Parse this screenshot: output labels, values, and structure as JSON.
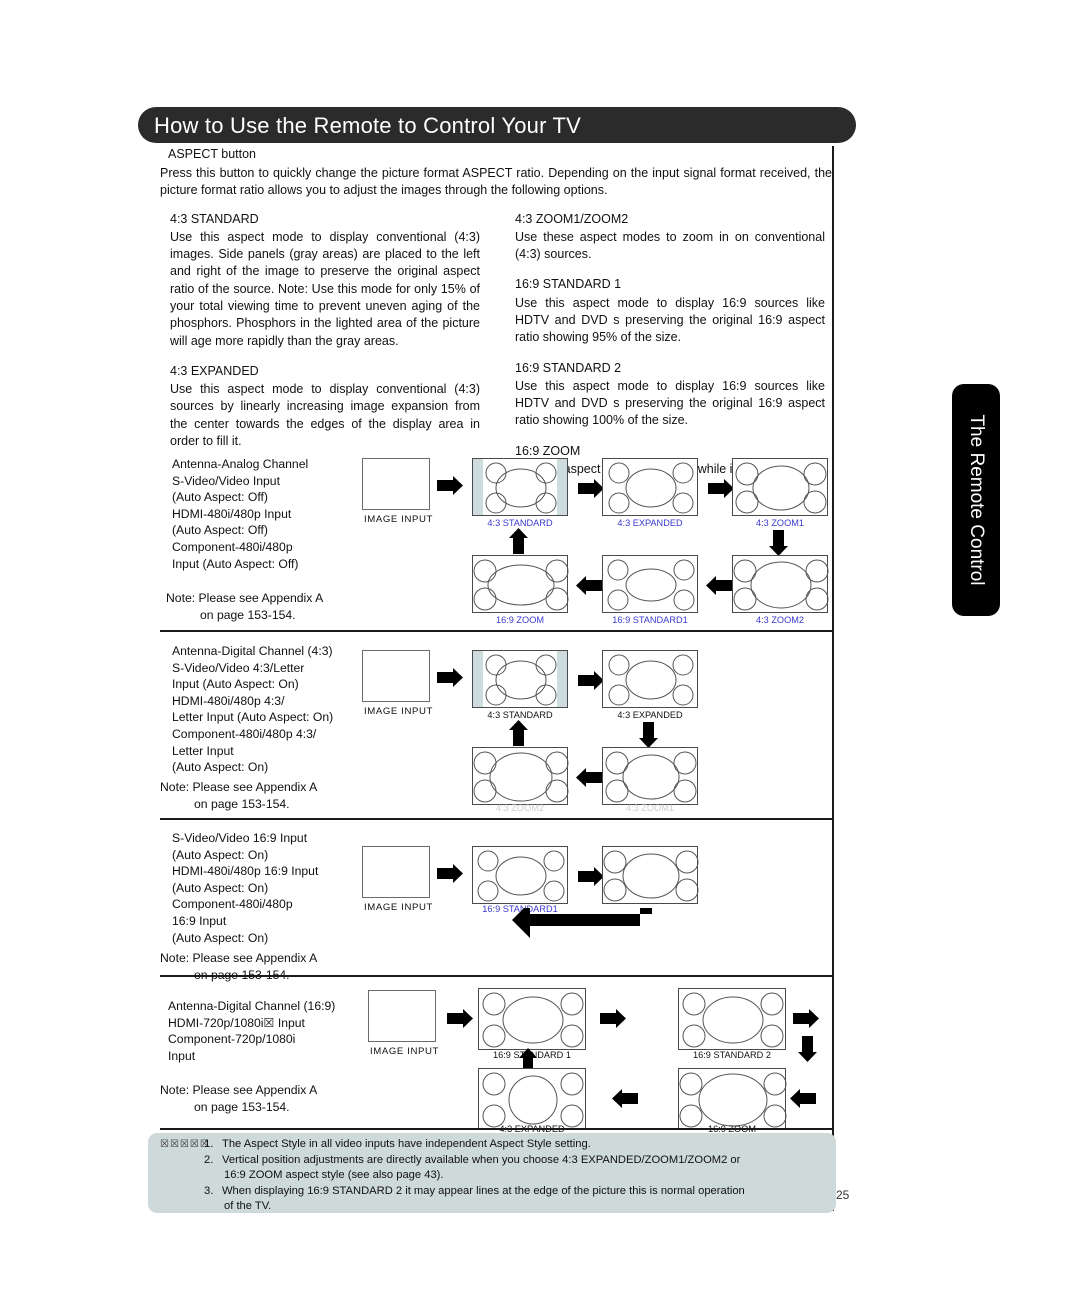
{
  "header": {
    "title": "How to Use the Remote to Control Your TV"
  },
  "side_tab": {
    "label": "The Remote Control"
  },
  "page_number": "25",
  "intro": {
    "button_label": "ASPECT button",
    "paragraph": "Press this button to quickly change the picture format  ASPECT ratio. Depending on the input signal format received, the picture format ratio allows you to adjust the images through the following options."
  },
  "descriptions": {
    "left": [
      {
        "title": "4:3 STANDARD",
        "body": "Use this aspect mode to display conventional (4:3) images. Side panels (gray areas) are placed to the left and right of the image to preserve the original aspect ratio of the source.  Note: Use this mode for only 15% of your total viewing time to prevent uneven aging of the phosphors.  Phosphors in the lighted area of the picture will age more rapidly than the gray areas."
      },
      {
        "title": "4:3 EXPANDED",
        "body": "Use this aspect mode to display conventional (4:3) sources by linearly increasing image expansion from the center towards the edges of the display area in order to fill it."
      }
    ],
    "right": [
      {
        "title": "4:3 ZOOM1/ZOOM2",
        "body": "Use these aspect modes to zoom in on conventional (4:3) sources."
      },
      {
        "title": "16:9 STANDARD 1",
        "body": "Use this aspect mode to display 16:9 sources like HDTV and DVD s preserving the original 16:9 aspect ratio showing 95% of the size."
      },
      {
        "title": "16:9 STANDARD 2",
        "body": "Use this aspect mode to display 16:9 sources like HDTV and DVD s preserving the original 16:9 aspect ratio showing 100% of the size."
      },
      {
        "title": "16:9 ZOOM",
        "body": "Use this aspect to Zoom-in once while in 16:9 aspect."
      }
    ]
  },
  "blocks": [
    {
      "inputs": [
        "Antenna-Analog Channel",
        "S-Video/Video Input",
        "(Auto Aspect: Off)",
        "HDMI-480i/480p Input",
        "(Auto Aspect: Off)",
        "Component-480i/480p",
        "Input (Auto Aspect: Off)"
      ],
      "note_line1": "Note:  Please see Appendix A",
      "note_line2": "on page  153-154.",
      "image_input_caption": "IMAGE INPUT",
      "screens": [
        {
          "label": "4:3 STANDARD",
          "color": "blue"
        },
        {
          "label": "4:3 EXPANDED",
          "color": "blue"
        },
        {
          "label": "4:3 ZOOM1",
          "color": "blue"
        },
        {
          "label": "4:3 ZOOM2",
          "color": "blue"
        },
        {
          "label": "16:9 STANDARD1",
          "color": "blue"
        },
        {
          "label": "16:9 ZOOM",
          "color": "blue"
        }
      ]
    },
    {
      "inputs": [
        "Antenna-Digital Channel (4:3)",
        "S-Video/Video 4:3/Letter",
        "Input (Auto Aspect: On)",
        "HDMI-480i/480p 4:3/",
        "Letter Input (Auto Aspect: On)",
        "Component-480i/480p 4:3/",
        "Letter Input",
        "(Auto Aspect: On)"
      ],
      "note_line1": "Note:  Please see Appendix  A",
      "note_line2": "on page  153-154.",
      "image_input_caption": "IMAGE INPUT",
      "screens": [
        {
          "label": "4:3 STANDARD",
          "color": "dark"
        },
        {
          "label": "4:3 EXPANDED",
          "color": "dark"
        },
        {
          "label": "4:3 ZOOM1",
          "color": "fade"
        },
        {
          "label": "4:3 ZOOM2",
          "color": "fade"
        }
      ]
    },
    {
      "inputs": [
        "S-Video/Video 16:9 Input",
        "(Auto Aspect: On)",
        "HDMI-480i/480p 16:9 Input",
        "(Auto Aspect: On)",
        "Component-480i/480p",
        "16:9 Input",
        "(Auto Aspect: On)"
      ],
      "note_line1": "Note:  Please see Appendix  A",
      "note_line2": "on page  153-154.",
      "image_input_caption": "IMAGE INPUT",
      "screens": [
        {
          "label": "16:9 STANDARD1",
          "color": "blue"
        },
        {
          "label": "",
          "color": "blue"
        }
      ]
    },
    {
      "inputs": [
        "Antenna-Digital Channel (16:9)",
        "HDMI-720p/1080i☒            Input",
        "Component-720p/1080i",
        "Input"
      ],
      "note_line1": "Note:  Please see Appendix  A",
      "note_line2": "on page  153-154.",
      "image_input_caption": "IMAGE INPUT",
      "screens": [
        {
          "label": "16:9 STANDARD 1",
          "color": "dark"
        },
        {
          "label": "16:9 STANDARD 2",
          "color": "dark"
        },
        {
          "label": "16:9 ZOOM",
          "color": "dark"
        },
        {
          "label": "4:3 EXPANDED",
          "color": "dark"
        }
      ]
    }
  ],
  "notes": {
    "badge": "☒☒☒☒☒",
    "items": [
      {
        "num": "1.",
        "text": "The Aspect Style in all video inputs have independent Aspect Style setting.",
        "cont": ""
      },
      {
        "num": "2.",
        "text": "Vertical position adjustments are directly available when you choose 4:3 EXPANDED/ZOOM1/ZOOM2 or",
        "cont": "16:9 ZOOM aspect style (see also page  43)."
      },
      {
        "num": "3.",
        "text": "When displaying 16:9 STANDARD 2 it may appear lines at the edge of the picture this is normal operation",
        "cont": "of the TV."
      }
    ]
  },
  "colors": {
    "header_bg": "#2b2b2b",
    "tab_bg": "#000000",
    "notes_bg": "#ced9da",
    "label_blue": "#3a3ad0",
    "panel_gray": "#cfdcdd"
  }
}
